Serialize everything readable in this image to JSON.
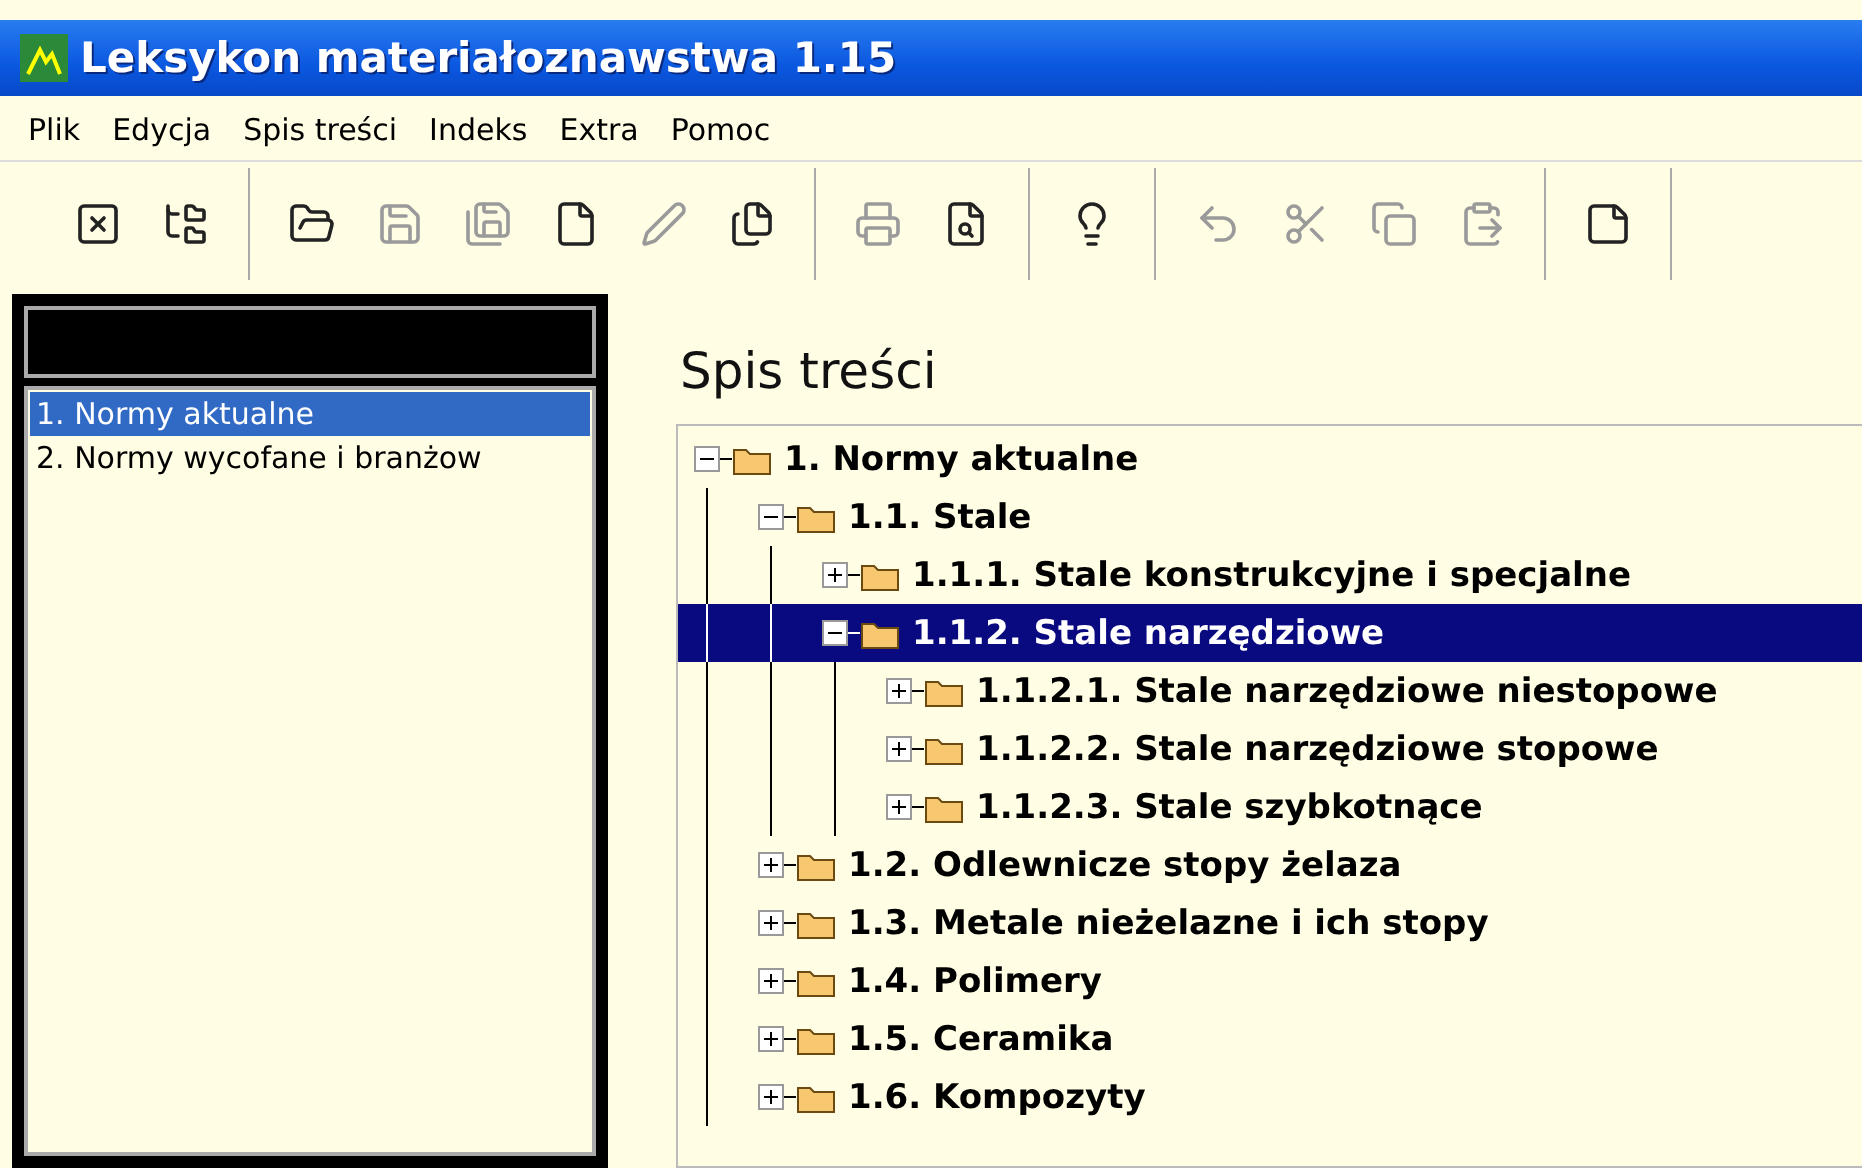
{
  "window": {
    "title": "Leksykon materiałoznawstwa 1.15"
  },
  "menu": [
    "Plik",
    "Edycja",
    "Spis treści",
    "Indeks",
    "Extra",
    "Pomoc"
  ],
  "toolbar": [
    [
      {
        "kind": "close",
        "disabled": false
      },
      {
        "kind": "tree",
        "disabled": false
      }
    ],
    [
      {
        "kind": "open",
        "disabled": false
      },
      {
        "kind": "save",
        "disabled": true
      },
      {
        "kind": "save-as",
        "disabled": true
      },
      {
        "kind": "new",
        "disabled": false
      },
      {
        "kind": "pen",
        "disabled": true
      },
      {
        "kind": "pages",
        "disabled": false
      }
    ],
    [
      {
        "kind": "print",
        "disabled": true
      },
      {
        "kind": "preview",
        "disabled": false
      }
    ],
    [
      {
        "kind": "hint",
        "disabled": false
      }
    ],
    [
      {
        "kind": "undo",
        "disabled": true
      },
      {
        "kind": "cut",
        "disabled": true
      },
      {
        "kind": "copy",
        "disabled": true
      },
      {
        "kind": "paste",
        "disabled": true
      }
    ],
    [
      {
        "kind": "note",
        "disabled": false
      }
    ]
  ],
  "sidebar": {
    "items": [
      {
        "label": "1. Normy aktualne",
        "selected": true
      },
      {
        "label": "2. Normy wycofane i branżow",
        "selected": false
      }
    ]
  },
  "content": {
    "heading": "Spis treści",
    "tree": [
      {
        "label": "1. Normy aktualne",
        "expanded": true,
        "selected": false,
        "children": [
          {
            "label": "1.1. Stale",
            "expanded": true,
            "selected": false,
            "children": [
              {
                "label": "1.1.1. Stale konstrukcyjne i specjalne",
                "expanded": false,
                "selected": false
              },
              {
                "label": "1.1.2. Stale narzędziowe",
                "expanded": true,
                "selected": true,
                "children": [
                  {
                    "label": "1.1.2.1. Stale narzędziowe niestopowe",
                    "expanded": false,
                    "selected": false
                  },
                  {
                    "label": "1.1.2.2. Stale narzędziowe stopowe",
                    "expanded": false,
                    "selected": false
                  },
                  {
                    "label": "1.1.2.3. Stale szybkotnące",
                    "expanded": false,
                    "selected": false
                  }
                ]
              }
            ]
          },
          {
            "label": "1.2. Odlewnicze stopy żelaza",
            "expanded": false,
            "selected": false
          },
          {
            "label": "1.3. Metale nieżelazne i ich stopy",
            "expanded": false,
            "selected": false
          },
          {
            "label": "1.4. Polimery",
            "expanded": false,
            "selected": false
          },
          {
            "label": "1.5. Ceramika",
            "expanded": false,
            "selected": false
          },
          {
            "label": "1.6. Kompozyty",
            "expanded": false,
            "selected": false
          }
        ]
      }
    ]
  }
}
